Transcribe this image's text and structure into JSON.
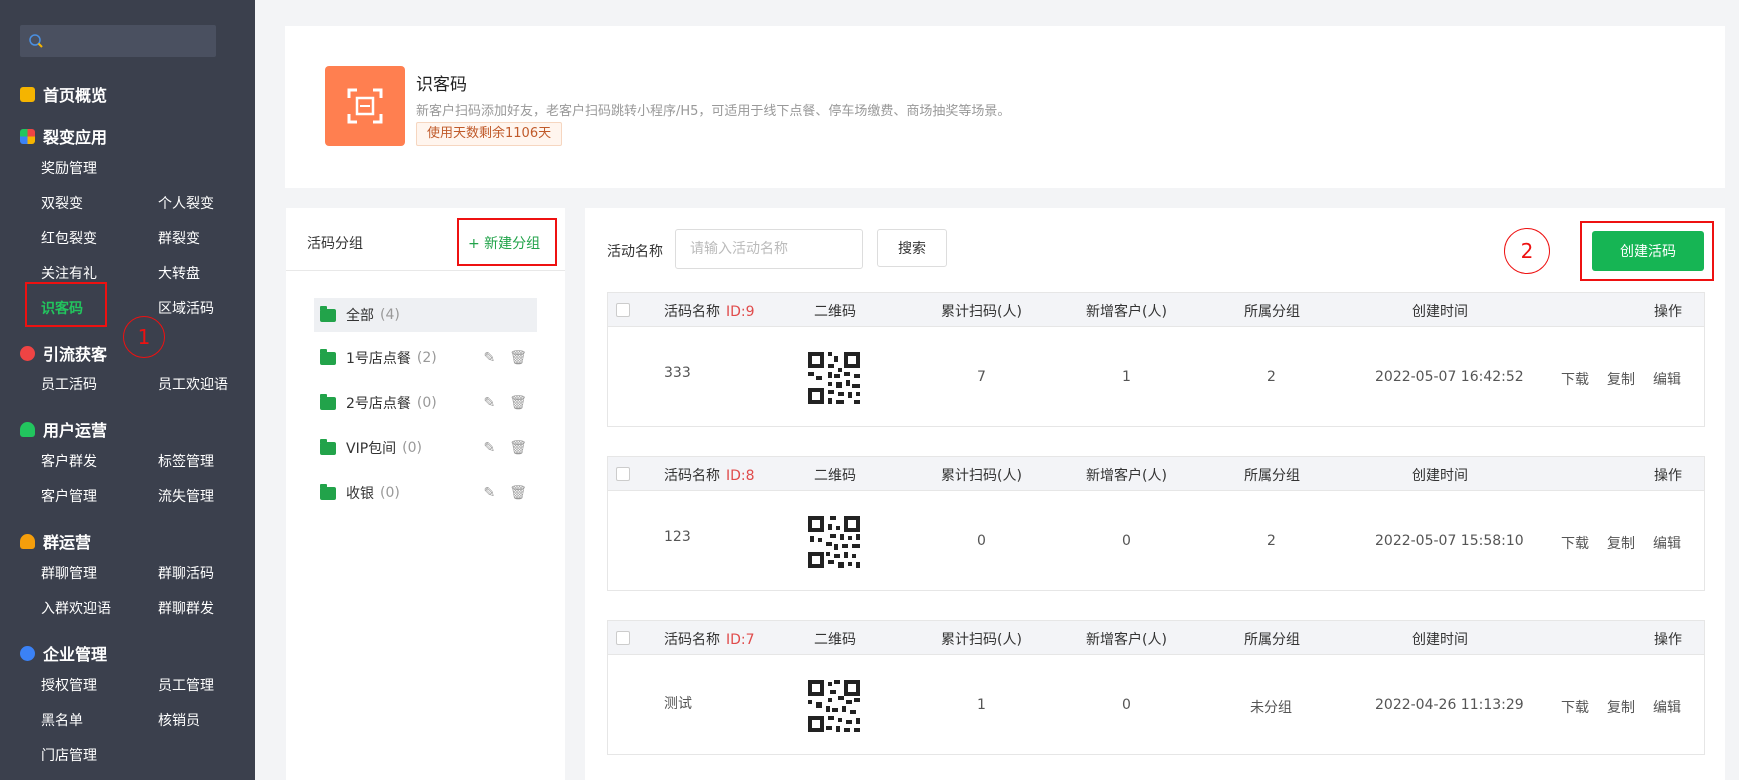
{
  "sidebar": {
    "sections": [
      {
        "title": "首页概览",
        "items": []
      },
      {
        "title": "裂变应用",
        "items": [
          "奖励管理",
          "双裂变",
          "个人裂变",
          "红包裂变",
          "群裂变",
          "关注有礼",
          "大转盘",
          "识客码",
          "区域活码"
        ]
      },
      {
        "title": "引流获客",
        "items": [
          "员工活码",
          "员工欢迎语"
        ]
      },
      {
        "title": "用户运营",
        "items": [
          "客户群发",
          "标签管理",
          "客户管理",
          "流失管理"
        ]
      },
      {
        "title": "群运营",
        "items": [
          "群聊管理",
          "群聊活码",
          "入群欢迎语",
          "群聊群发"
        ]
      },
      {
        "title": "企业管理",
        "items": [
          "授权管理",
          "员工管理",
          "黑名单",
          "核销员",
          "门店管理"
        ]
      }
    ],
    "annotation_1": "1"
  },
  "app": {
    "title": "识客码",
    "desc": "新客户扫码添加好友，老客户扫码跳转小程序/H5，可适用于线下点餐、停车场缴费、商场抽奖等场景。",
    "badge": "使用天数剩余1106天"
  },
  "groups": {
    "title": "活码分组",
    "new_label": "+ 新建分组",
    "items": [
      {
        "name": "全部",
        "count": "(4)"
      },
      {
        "name": "1号店点餐",
        "count": "(2)"
      },
      {
        "name": "2号店点餐",
        "count": "(0)"
      },
      {
        "name": "VIP包间",
        "count": "(0)"
      },
      {
        "name": "收银",
        "count": "(0)"
      }
    ]
  },
  "filter": {
    "label": "活动名称",
    "placeholder": "请输入活动名称",
    "search_label": "搜索",
    "create_label": "创建活码",
    "annotation_2": "2"
  },
  "table": {
    "headers": {
      "name": "活码名称",
      "qr": "二维码",
      "scans": "累计扫码(人)",
      "new": "新增客户(人)",
      "group": "所属分组",
      "created": "创建时间",
      "ops": "操作"
    },
    "ops": [
      "下载",
      "复制",
      "编辑"
    ],
    "rows": [
      {
        "id": "ID:9",
        "name": "333",
        "scans": "7",
        "new": "1",
        "group": "2",
        "created": "2022-05-07 16:42:52"
      },
      {
        "id": "ID:8",
        "name": "123",
        "scans": "0",
        "new": "0",
        "group": "2",
        "created": "2022-05-07 15:58:10"
      },
      {
        "id": "ID:7",
        "name": "测试",
        "scans": "1",
        "new": "0",
        "group": "未分组",
        "created": "2022-04-26 11:13:29"
      }
    ]
  },
  "colors": {
    "sidebar_bg": "#3b404d",
    "accent": "#16b554",
    "app_icon": "#ff7f50",
    "annotation": "#e11111",
    "link": "#3b82f6"
  }
}
